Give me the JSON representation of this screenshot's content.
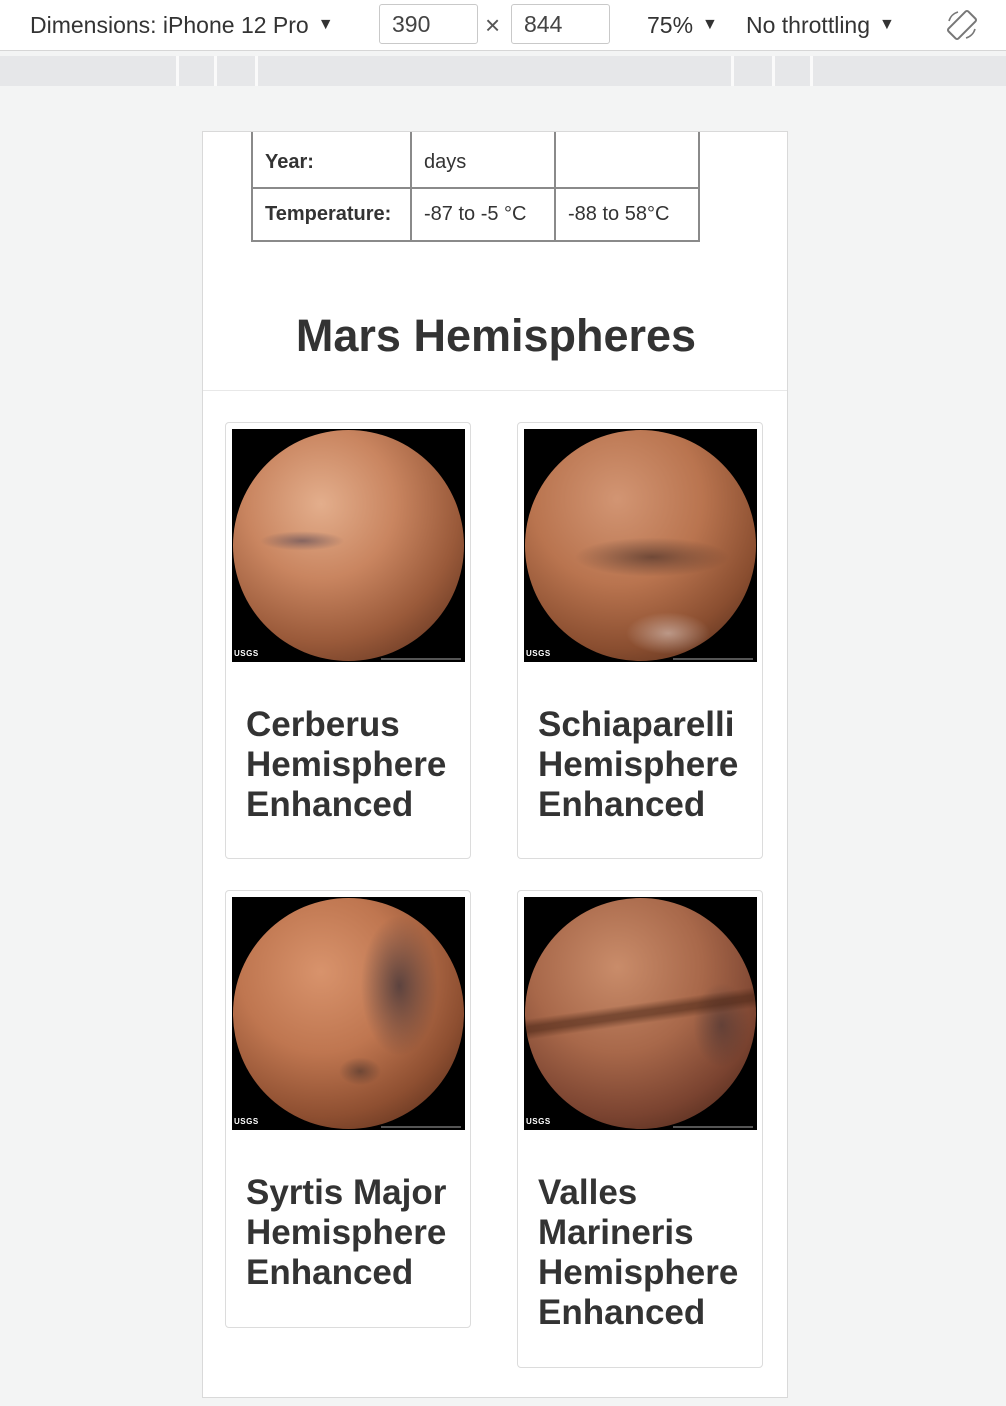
{
  "devtools": {
    "dimensions_label": "Dimensions: iPhone 12 Pro",
    "width": "390",
    "times": "×",
    "height": "844",
    "zoom": "75%",
    "throttling": "No throttling"
  },
  "facts_table": {
    "rows": [
      {
        "label": "Year:",
        "mars": "days",
        "earth": ""
      },
      {
        "label": "Temperature:",
        "mars": "-87 to -5 °C",
        "earth": "-88 to 58°C"
      }
    ]
  },
  "hemispheres": {
    "title": "Mars Hemispheres",
    "items": [
      {
        "title": "Cerberus Hemisphere Enhanced",
        "usgs": "USGS"
      },
      {
        "title": "Schiaparelli Hemisphere Enhanced",
        "usgs": "USGS"
      },
      {
        "title": "Syrtis Major Hemisphere Enhanced",
        "usgs": "USGS"
      },
      {
        "title": "Valles Marineris Hemisphere Enhanced",
        "usgs": "USGS"
      }
    ]
  },
  "colors": {
    "mars_light": "#d89a72",
    "mars_dark": "#6a3a24",
    "text": "#333333"
  }
}
